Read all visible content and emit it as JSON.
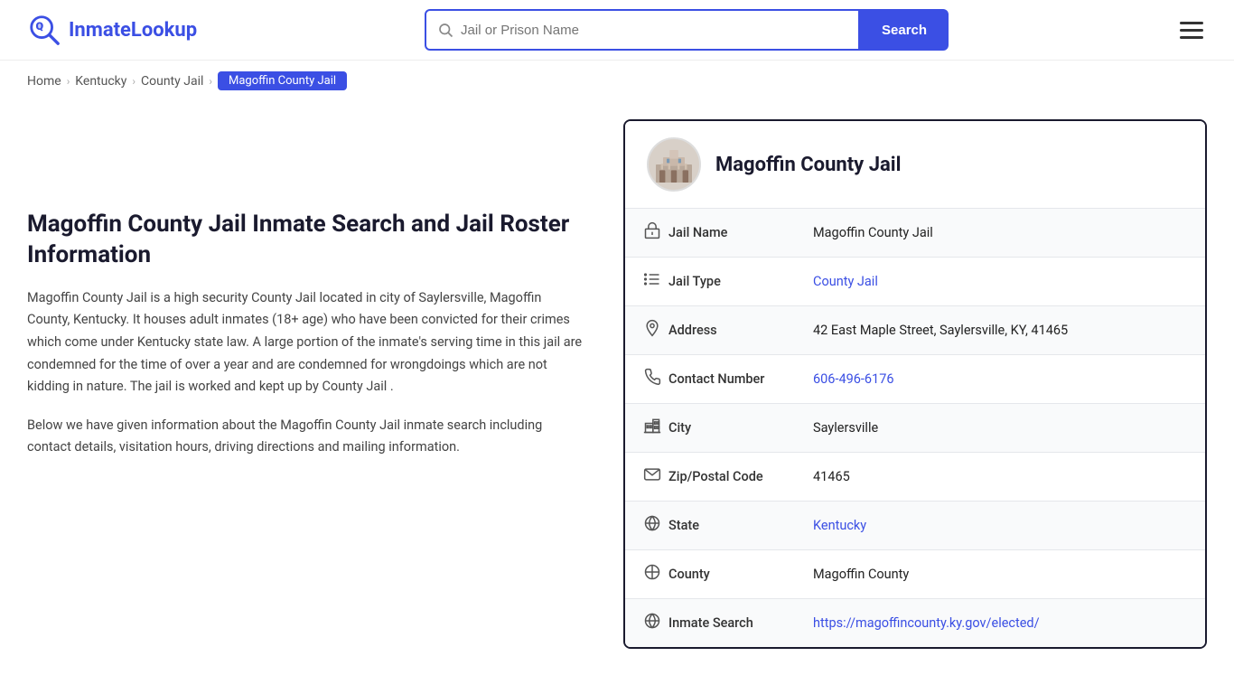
{
  "header": {
    "logo_text_prefix": "Inmate",
    "logo_text_suffix": "Lookup",
    "search_placeholder": "Jail or Prison Name",
    "search_button_label": "Search"
  },
  "breadcrumb": {
    "home": "Home",
    "state": "Kentucky",
    "type": "County Jail",
    "current": "Magoffin County Jail"
  },
  "left": {
    "title": "Magoffin County Jail Inmate Search and Jail Roster Information",
    "desc1": "Magoffin County Jail is a high security County Jail located in city of Saylersville, Magoffin County, Kentucky. It houses adult inmates (18+ age) who have been convicted for their crimes which come under Kentucky state law. A large portion of the inmate's serving time in this jail are condemned for the time of over a year and are condemned for wrongdoings which are not kidding in nature. The jail is worked and kept up by County Jail .",
    "desc2": "Below we have given information about the Magoffin County Jail inmate search including contact details, visitation hours, driving directions and mailing information."
  },
  "card": {
    "title": "Magoffin County Jail",
    "rows": [
      {
        "icon": "jail-icon",
        "label": "Jail Name",
        "value": "Magoffin County Jail",
        "link": null
      },
      {
        "icon": "list-icon",
        "label": "Jail Type",
        "value": "County Jail",
        "link": "#"
      },
      {
        "icon": "pin-icon",
        "label": "Address",
        "value": "42 East Maple Street, Saylersville, KY, 41465",
        "link": null
      },
      {
        "icon": "phone-icon",
        "label": "Contact Number",
        "value": "606-496-6176",
        "link": "tel:606-496-6176"
      },
      {
        "icon": "city-icon",
        "label": "City",
        "value": "Saylersville",
        "link": null
      },
      {
        "icon": "mail-icon",
        "label": "Zip/Postal Code",
        "value": "41465",
        "link": null
      },
      {
        "icon": "globe-icon",
        "label": "State",
        "value": "Kentucky",
        "link": "#"
      },
      {
        "icon": "county-icon",
        "label": "County",
        "value": "Magoffin County",
        "link": null
      },
      {
        "icon": "search-globe-icon",
        "label": "Inmate Search",
        "value": "https://magoffincounty.ky.gov/elected/",
        "link": "https://magoffincounty.ky.gov/elected/"
      }
    ]
  }
}
